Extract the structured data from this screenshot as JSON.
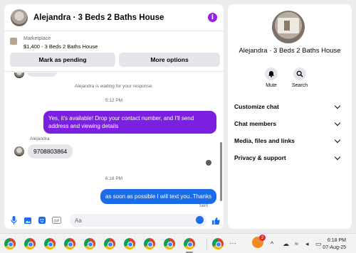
{
  "chat": {
    "title": "Alejandra · 3 Beds 2 Baths House",
    "marketplace": {
      "label": "Marketplace",
      "listing": "$1,400 - 3 Beds 2 Baths House",
      "btn_pending": "Mark as pending",
      "btn_more": "More options"
    },
    "system_message": "Alejandra is waiting for your response.",
    "time_1": "5:12 PM",
    "msg_out_1": "Yes, it's available! Drop your contact number, and I'll send address and viewing details",
    "sender_name": "Alejandra",
    "msg_in_1": "9708803864",
    "time_2": "6:18 PM",
    "msg_out_2": "as soon as possible I will text you..Thanks",
    "status": "Sent",
    "input_placeholder": "Aa"
  },
  "details": {
    "name": "Alejandra · 3 Beds 2 Baths House",
    "actions": [
      {
        "label": "Mute",
        "icon": "bell-icon"
      },
      {
        "label": "Search",
        "icon": "search-icon"
      }
    ],
    "sections": [
      "Customize chat",
      "Chat members",
      "Media, files and links",
      "Privacy & support"
    ]
  },
  "taskbar": {
    "more": "···",
    "notification_count": "2",
    "time": "6:18 PM",
    "date": "07-Aug-25"
  },
  "colors": {
    "outgoing_purple": "#7b1fe0",
    "outgoing_blue": "#1a6ce8",
    "info_purple": "#9b1fe8"
  }
}
